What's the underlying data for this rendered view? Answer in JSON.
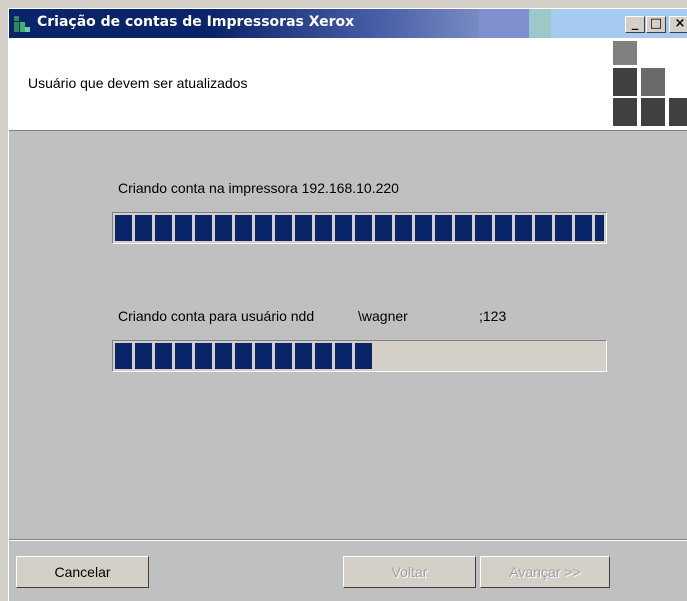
{
  "window": {
    "title": "Criação de contas de Impressoras Xerox",
    "controls": {
      "minimize": "_",
      "maximize": "□",
      "close": "×"
    }
  },
  "header": {
    "subtitle": "Usuário que devem ser atualizados"
  },
  "tasks": [
    {
      "label": "Criando conta na impressora 192.168.10.220",
      "progress": 1.0
    },
    {
      "label_prefix": "Criando conta para usuário ndd",
      "label_user": "\\wagner",
      "label_code": ";123",
      "progress": 0.53
    }
  ],
  "buttons": {
    "cancel": "Cancelar",
    "back": "Voltar",
    "next": "Avançar >>"
  },
  "colors": {
    "title_bar": "#0a246a",
    "progress_fill": "#0a246a",
    "face": "#c0c0c0"
  }
}
